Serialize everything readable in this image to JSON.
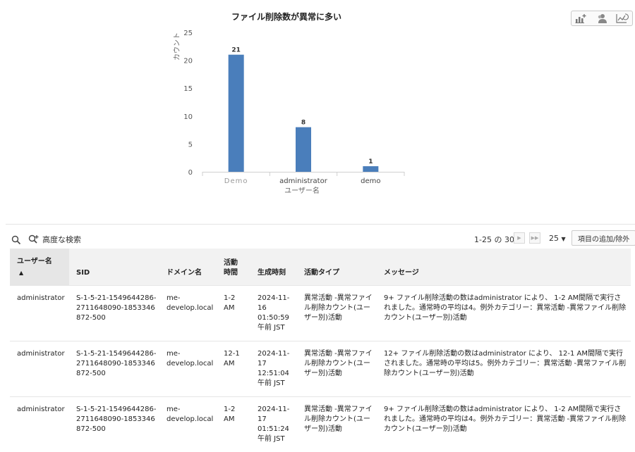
{
  "chart_data": {
    "type": "bar",
    "title": "ファイル削除数が異常に多い",
    "categories": [
      "Demo",
      "administrator",
      "demo"
    ],
    "values": [
      21,
      8,
      1
    ],
    "xlabel": "ユーザー名",
    "ylabel": "カウント",
    "ylim": [
      0,
      25
    ],
    "yticks": [
      0,
      5,
      10,
      15,
      20,
      25
    ],
    "grid": false,
    "legend": "none",
    "bar_color": "#4a7ebb",
    "blurred_categories": [
      0
    ]
  },
  "chart_toolbar": {
    "icons": [
      "add-chart-icon",
      "user-icon",
      "chart-type-icon"
    ]
  },
  "toolbar": {
    "advanced_search": "高度な検索",
    "pager_text": "1-25 の 30",
    "per_page": "25",
    "add_remove_label": "項目の追加/除外"
  },
  "table": {
    "columns": [
      "ユーザー名",
      "SID",
      "ドメイン名",
      "活動\n時間",
      "生成時刻",
      "活動タイプ",
      "メッセージ"
    ],
    "rows": [
      {
        "user": "administrator",
        "sid": "S-1-5-21-1549644286-2711648090-1853346872-500",
        "domain": "me-\ndevelop.local",
        "time": "1-2\nAM",
        "generated": "2024-11-\n16\n01:50:59\n午前 JST",
        "type": "異常活動 -異常ファイル削除カウント(ユーザー別)活動",
        "message": "9+ ファイル削除活動の数はadministrator により、 1-2 AM間隔で実行されました。通常時の平均は4。例外カテゴリー：異常活動 -異常ファイル削除カウント(ユーザー別)活動"
      },
      {
        "user": "administrator",
        "sid": "S-1-5-21-1549644286-2711648090-1853346872-500",
        "domain": "me-\ndevelop.local",
        "time": "12-1\nAM",
        "generated": "2024-11-\n17\n12:51:04\n午前 JST",
        "type": "異常活動 -異常ファイル削除カウント(ユーザー別)活動",
        "message": "12+ ファイル削除活動の数はadministrator により、 12-1 AM間隔で実行されました。通常時の平均は5。例外カテゴリー：異常活動 -異常ファイル削除カウント(ユーザー別)活動"
      },
      {
        "user": "administrator",
        "sid": "S-1-5-21-1549644286-2711648090-1853346872-500",
        "domain": "me-\ndevelop.local",
        "time": "1-2\nAM",
        "generated": "2024-11-\n17\n01:51:24\n午前 JST",
        "type": "異常活動 -異常ファイル削除カウント(ユーザー別)活動",
        "message": "9+ ファイル削除活動の数はadministrator により、 1-2 AM間隔で実行されました。通常時の平均は4。例外カテゴリー：異常活動 -異常ファイル削除カウント(ユーザー別)活動"
      }
    ]
  }
}
